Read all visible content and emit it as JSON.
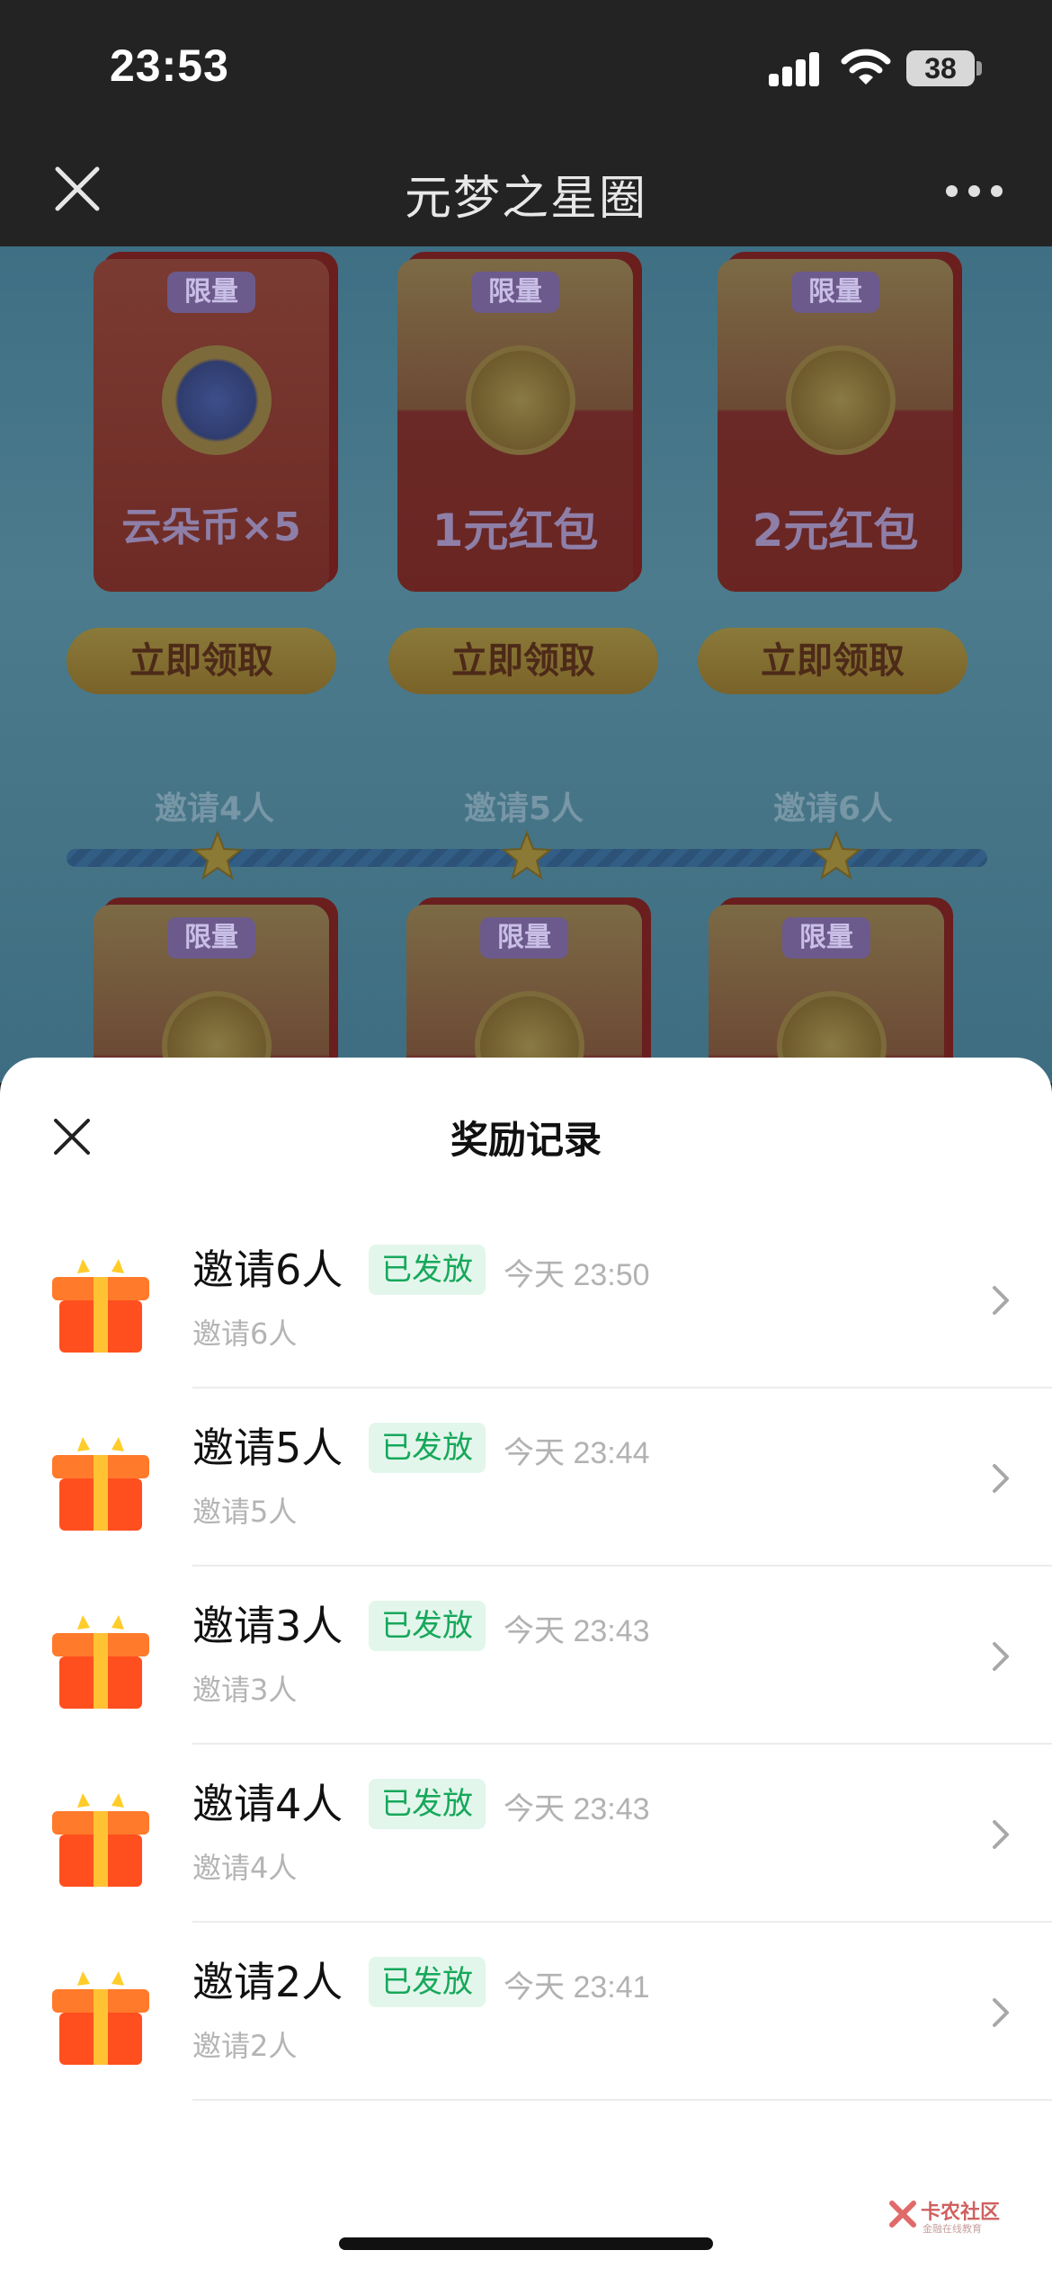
{
  "status_bar": {
    "time": "23:53",
    "battery": "38"
  },
  "nav": {
    "title": "元梦之星圈"
  },
  "background": {
    "cards_top": [
      {
        "tag": "限量",
        "label": "云朵币×5"
      },
      {
        "tag": "限量",
        "label": "1元红包"
      },
      {
        "tag": "限量",
        "label": "2元红包"
      }
    ],
    "claim_buttons": [
      "立即领取",
      "立即领取",
      "立即领取"
    ],
    "milestones": [
      "邀请4人",
      "邀请5人",
      "邀请6人"
    ],
    "cards_bottom": [
      {
        "tag": "限量"
      },
      {
        "tag": "限量"
      },
      {
        "tag": "限量"
      }
    ]
  },
  "sheet": {
    "title": "奖励记录",
    "records": [
      {
        "title": "邀请6人",
        "status": "已发放",
        "time": "今天 23:50",
        "subtitle": "邀请6人"
      },
      {
        "title": "邀请5人",
        "status": "已发放",
        "time": "今天 23:44",
        "subtitle": "邀请5人"
      },
      {
        "title": "邀请3人",
        "status": "已发放",
        "time": "今天 23:43",
        "subtitle": "邀请3人"
      },
      {
        "title": "邀请4人",
        "status": "已发放",
        "time": "今天 23:43",
        "subtitle": "邀请4人"
      },
      {
        "title": "邀请2人",
        "status": "已发放",
        "time": "今天 23:41",
        "subtitle": "邀请2人"
      }
    ]
  },
  "watermark": {
    "name": "卡农社区",
    "tagline": "金融在线教育"
  }
}
